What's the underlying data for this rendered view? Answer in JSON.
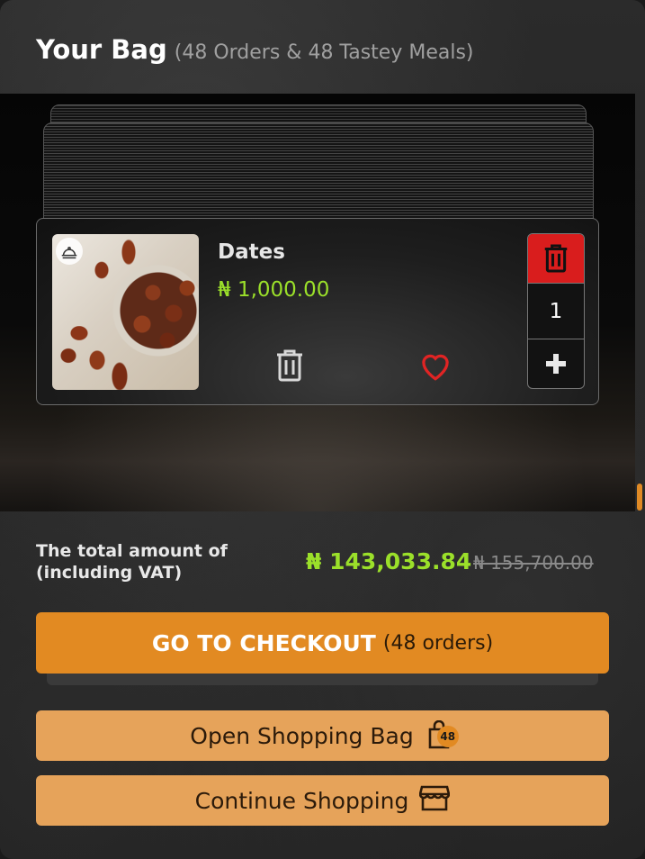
{
  "header": {
    "title": "Your Bag",
    "subtitle": "(48 Orders & 48 Tastey Meals)"
  },
  "item": {
    "name": "Dates",
    "price": "₦ 1,000.00",
    "quantity": "1",
    "image_icon": "cloche-icon",
    "icons": [
      "trash-icon",
      "heart-icon",
      "plus-icon",
      "cloche-icon"
    ]
  },
  "summary": {
    "label": "The total amount of (including VAT)",
    "total": "₦ 143,033.84",
    "original_total": "₦ 155,700.00"
  },
  "checkout": {
    "label": "GO TO CHECKOUT",
    "count": "(48 orders)"
  },
  "open_bag": {
    "label": "Open Shopping Bag",
    "badge": "48"
  },
  "continue": {
    "label": "Continue Shopping"
  },
  "colors": {
    "accent": "#e28a22",
    "accent_light": "#e6a35a",
    "price_green": "#9be02a",
    "delete_red": "#d91d1d"
  }
}
